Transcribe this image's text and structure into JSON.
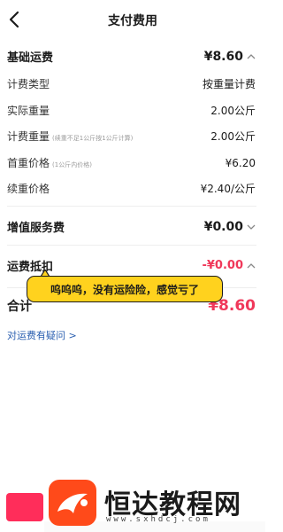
{
  "header": {
    "title": "支付费用"
  },
  "base_fee": {
    "title": "基础运费",
    "amount": "¥8.60",
    "rows": [
      {
        "label": "计费类型",
        "note": "",
        "value": "按重量计费"
      },
      {
        "label": "实际重量",
        "note": "",
        "value": "2.00公斤"
      },
      {
        "label": "计费重量",
        "note": "(续重不足1公斤按1公斤计算)",
        "value": "2.00公斤"
      },
      {
        "label": "首重价格",
        "note": "(1公斤内价格)",
        "value": "¥6.20"
      },
      {
        "label": "续重价格",
        "note": "",
        "value": "¥2.40/公斤"
      }
    ]
  },
  "value_added": {
    "title": "增值服务费",
    "amount": "¥0.00"
  },
  "deduction": {
    "title": "运费抵扣",
    "amount": "-¥0.00"
  },
  "tooltip": {
    "text": "呜呜呜，没有运险险，感觉亏了"
  },
  "total": {
    "label": "合计",
    "amount": "¥8.60"
  },
  "link": {
    "label": "对运费有疑问 >"
  },
  "watermark": {
    "text": "恒达教程网",
    "url": "www.sxhdcj.com"
  },
  "colors": {
    "accent": "#f0385a",
    "tooltip_bg": "#ffd21e",
    "link": "#2a5fb0"
  }
}
